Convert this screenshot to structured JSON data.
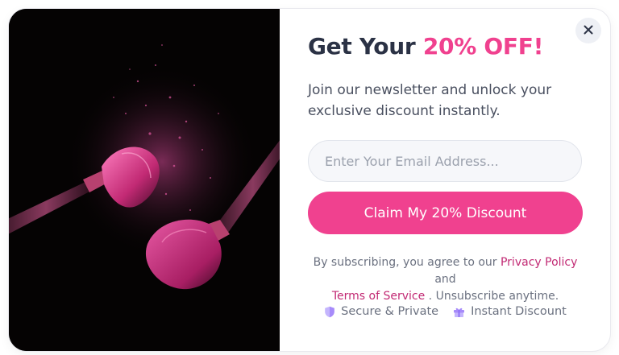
{
  "close_label": "×",
  "headline": {
    "prefix": "Get Your ",
    "highlight": "20% OFF!"
  },
  "subtitle": "Join our newsletter and unlock your exclusive discount instantly.",
  "email": {
    "placeholder": "Enter Your Email Address...",
    "value": ""
  },
  "cta": {
    "label": "Claim My 20% Discount"
  },
  "terms": {
    "text_1": "By subscribing, you agree to our ",
    "privacy_link": "Privacy Policy",
    "text_2": " and ",
    "terms_link": "Terms of Service",
    "text_3": " . Unsubscribe anytime."
  },
  "features": [
    {
      "label": "Secure & Private",
      "icon": "shield-icon"
    },
    {
      "label": "Instant Discount",
      "icon": "gift-icon"
    }
  ],
  "colors": {
    "accent": "#f0418f",
    "link": "#c22a74",
    "heading": "#2b3245",
    "icon": "#a78bfa"
  }
}
